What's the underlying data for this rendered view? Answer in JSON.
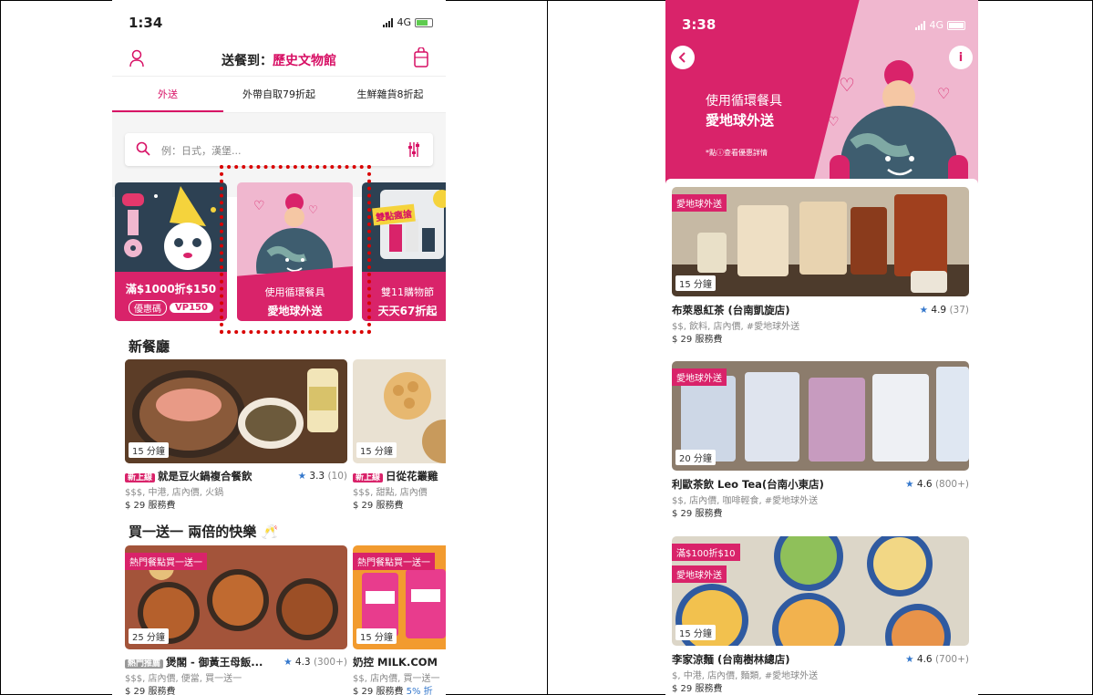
{
  "left": {
    "status": {
      "time": "1:34",
      "network": "4G"
    },
    "header": {
      "deliver_label": "送餐到：",
      "location": "歷史文物館"
    },
    "tabs": [
      {
        "label": "外送"
      },
      {
        "label": "外帶自取79折起"
      },
      {
        "label": "生鮮雜貨8折起"
      }
    ],
    "search": {
      "placeholder": "例：日式，漢堡..."
    },
    "banners": [
      {
        "line1": "滿$1000折$150",
        "coupon_label": "優惠碼",
        "coupon_code": "VP150"
      },
      {
        "line1": "使用循環餐具",
        "line2": "愛地球外送"
      },
      {
        "tag": "雙點瘋搶",
        "line1": "雙11購物節",
        "line2": "天天67折起"
      }
    ],
    "sections": {
      "new_restaurants": "新餐廳",
      "bogo": "買一送一 兩倍的快樂 🥂"
    },
    "new_restaurants": [
      {
        "minutes": "15 分鐘",
        "badge": "新上線",
        "name": "就是豆火鍋複合餐飲",
        "rating": "3.3",
        "count": "(10)",
        "meta": "$$$, 中港, 店內價, 火鍋",
        "fee": "$ 29 服務費"
      },
      {
        "minutes": "15 分鐘",
        "badge": "新上線",
        "name": "日從花叢雞",
        "meta": "$$$, 甜點, 店內價",
        "fee": "$ 29 服務費"
      }
    ],
    "bogo_restaurants": [
      {
        "promo": "熱門餐點買一送一",
        "minutes": "25 分鐘",
        "badge": "熱門推薦",
        "name": "煲閣 - 御黃王母飯...",
        "rating": "4.3",
        "count": "(300+)",
        "meta": "$$$, 店內價, 便當, 買一送一",
        "fee": "$ 29 服務費"
      },
      {
        "promo": "熱門餐點買一送一",
        "minutes": "15 分鐘",
        "name": "奶控 MILK.COM",
        "meta": "$$, 店內價, 買一送一",
        "fee": "$ 29 服務費",
        "discount": "5% 折"
      }
    ]
  },
  "right": {
    "status": {
      "time": "3:38",
      "network": "4G"
    },
    "hero": {
      "line1": "使用循環餐具",
      "line2": "愛地球外送",
      "note": "*點ⓘ查看優惠詳情"
    },
    "restaurants": [
      {
        "pills": [
          "愛地球外送"
        ],
        "minutes": "15 分鐘",
        "name": "布萊恩紅茶 (台南凱旋店)",
        "rating": "4.9",
        "count": "(37)",
        "meta": "$$, 飲料, 店內價, #愛地球外送",
        "fee": "$ 29 服務費"
      },
      {
        "pills": [
          "愛地球外送"
        ],
        "minutes": "20 分鐘",
        "name": "利歐茶飲 Leo Tea(台南小東店)",
        "rating": "4.6",
        "count": "(800+)",
        "meta": "$$, 店內價, 咖啡輕食, #愛地球外送",
        "fee": "$ 29 服務費"
      },
      {
        "pills": [
          "滿$100折$10",
          "愛地球外送"
        ],
        "minutes": "15 分鐘",
        "name": "李家涼麵 (台南樹林總店)",
        "rating": "4.6",
        "count": "(700+)",
        "meta": "$, 中港, 店內價, 麵類, #愛地球外送",
        "fee": "$ 29 服務費"
      }
    ]
  },
  "colors": {
    "brand": "#d70f64",
    "rating_star": "#3377cc"
  }
}
